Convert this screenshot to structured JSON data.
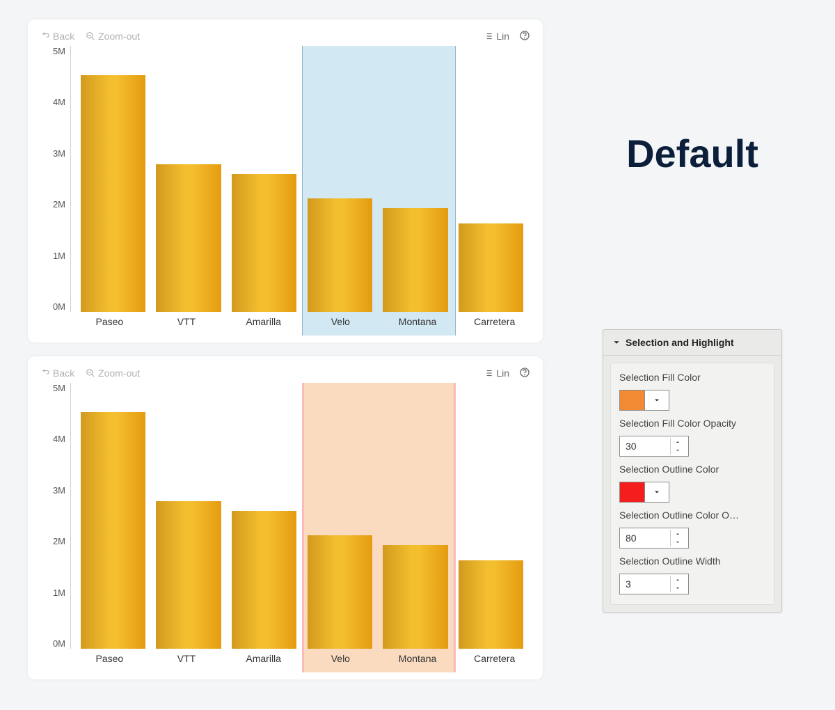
{
  "chart_data": [
    {
      "type": "bar",
      "categories": [
        "Paseo",
        "VTT",
        "Amarilla",
        "Velo",
        "Montana",
        "Carretera"
      ],
      "values": [
        4800000,
        3000000,
        2800000,
        2300000,
        2100000,
        1800000
      ],
      "ylabel": "",
      "xlabel": "",
      "ylim": [
        0,
        5400000
      ],
      "yticks": [
        "5M",
        "4M",
        "3M",
        "2M",
        "1M",
        "0M"
      ],
      "selection": {
        "start_index": 3,
        "end_index": 4,
        "fill": "#cbe5f1",
        "outline": "#7aa7bd",
        "opacity": 0.85,
        "outline_width": 1
      }
    },
    {
      "type": "bar",
      "categories": [
        "Paseo",
        "VTT",
        "Amarilla",
        "Velo",
        "Montana",
        "Carretera"
      ],
      "values": [
        4800000,
        3000000,
        2800000,
        2300000,
        2100000,
        1800000
      ],
      "ylabel": "",
      "xlabel": "",
      "ylim": [
        0,
        5400000
      ],
      "yticks": [
        "5M",
        "4M",
        "3M",
        "2M",
        "1M",
        "0M"
      ],
      "selection": {
        "start_index": 3,
        "end_index": 4,
        "fill": "#f18a32",
        "outline": "#f41e1e",
        "opacity": 0.3,
        "outline_width": 3
      }
    }
  ],
  "toolbar": {
    "back": "Back",
    "zoom_out": "Zoom-out",
    "lin": "Lin"
  },
  "heading": "Default",
  "panel": {
    "title": "Selection and Highlight",
    "fields": {
      "fill_color": {
        "label": "Selection Fill Color",
        "color": "#f18a32"
      },
      "fill_opacity": {
        "label": "Selection Fill Color Opacity",
        "value": "30"
      },
      "outline_color": {
        "label": "Selection Outline Color",
        "color": "#f41e1e"
      },
      "outline_opacity": {
        "label": "Selection Outline Color O…",
        "value": "80"
      },
      "outline_width": {
        "label": "Selection Outline Width",
        "value": "3"
      }
    }
  }
}
